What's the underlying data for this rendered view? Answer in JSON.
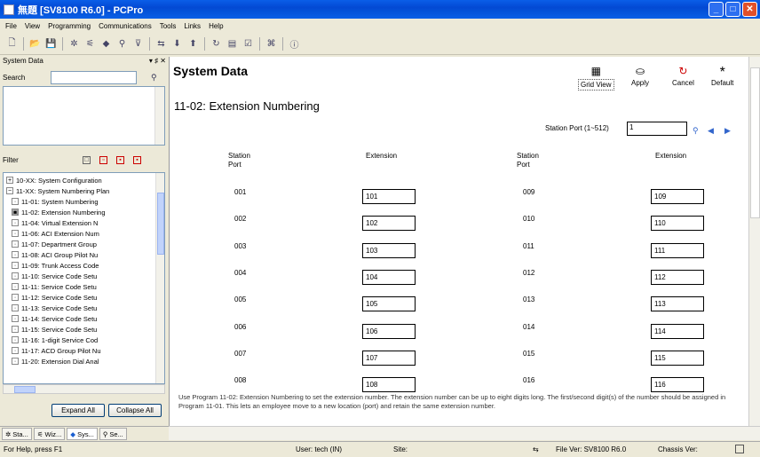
{
  "window": {
    "title": "無題 [SV8100 R6.0] - PCPro"
  },
  "menu": [
    "File",
    "View",
    "Programming",
    "Communications",
    "Tools",
    "Links",
    "Help"
  ],
  "leftpanel": {
    "title": "System Data",
    "pin": "▾ ♯ ✕",
    "search_label": "Search",
    "filter_label": "Filter",
    "tree": [
      {
        "box": "+",
        "label": "10-XX: System Configuration"
      },
      {
        "box": "−",
        "label": "11-XX: System Numbering Plan"
      },
      {
        "box": "·",
        "label": "11-01: System Numbering"
      },
      {
        "box": "▣",
        "label": "11-02: Extension Numbering"
      },
      {
        "box": "·",
        "label": "11-04: Virtual Extension N"
      },
      {
        "box": "·",
        "label": "11-06: ACI Extension Num"
      },
      {
        "box": "·",
        "label": "11-07: Department Group"
      },
      {
        "box": "·",
        "label": "11-08: ACI Group Pilot Nu"
      },
      {
        "box": "·",
        "label": "11-09: Trunk Access Code"
      },
      {
        "box": "·",
        "label": "11-10: Service Code Setu"
      },
      {
        "box": "·",
        "label": "11-11: Service Code Setu"
      },
      {
        "box": "·",
        "label": "11-12: Service Code Setu"
      },
      {
        "box": "·",
        "label": "11-13: Service Code Setu"
      },
      {
        "box": "·",
        "label": "11-14: Service Code Setu"
      },
      {
        "box": "·",
        "label": "11-15: Service Code Setu"
      },
      {
        "box": "·",
        "label": "11-16: 1-digit Service Cod"
      },
      {
        "box": "·",
        "label": "11-17: ACD Group Pilot Nu"
      },
      {
        "box": "·",
        "label": "11-20: Extension Dial Anal"
      }
    ],
    "expand_all": "Expand All",
    "collapse_all": "Collapse All",
    "tabs": [
      "Sta...",
      "Wiz...",
      "Sys...",
      "Se..."
    ]
  },
  "main": {
    "title": "System Data",
    "actions": {
      "grid_view": "Grid View",
      "apply": "Apply",
      "cancel": "Cancel",
      "default": "Default"
    },
    "section": "11-02: Extension Numbering",
    "station_port_label": "Station Port (1~512)",
    "station_port_value": "1",
    "col_station": [
      "Station",
      "Port"
    ],
    "col_extension": "Extension",
    "rows_left": [
      [
        "001",
        "101"
      ],
      [
        "002",
        "102"
      ],
      [
        "003",
        "103"
      ],
      [
        "004",
        "104"
      ],
      [
        "005",
        "105"
      ],
      [
        "006",
        "106"
      ],
      [
        "007",
        "107"
      ],
      [
        "008",
        "108"
      ]
    ],
    "rows_right": [
      [
        "009",
        "109"
      ],
      [
        "010",
        "110"
      ],
      [
        "011",
        "111"
      ],
      [
        "012",
        "112"
      ],
      [
        "013",
        "113"
      ],
      [
        "014",
        "114"
      ],
      [
        "015",
        "115"
      ],
      [
        "016",
        "116"
      ]
    ],
    "description": "Use Program 11-02: Extension Numbering to set the extension number. The extension number can be up to eight digits long. The first/second digit(s) of the number should be assigned in Program 11-01. This lets an employee move to a new location (port) and retain the same extension number."
  },
  "status": {
    "help": "For Help, press F1",
    "user": "User: tech (IN)",
    "site": "Site:",
    "filever": "File Ver: SV8100 R6.0",
    "chassis": "Chassis Ver:"
  }
}
